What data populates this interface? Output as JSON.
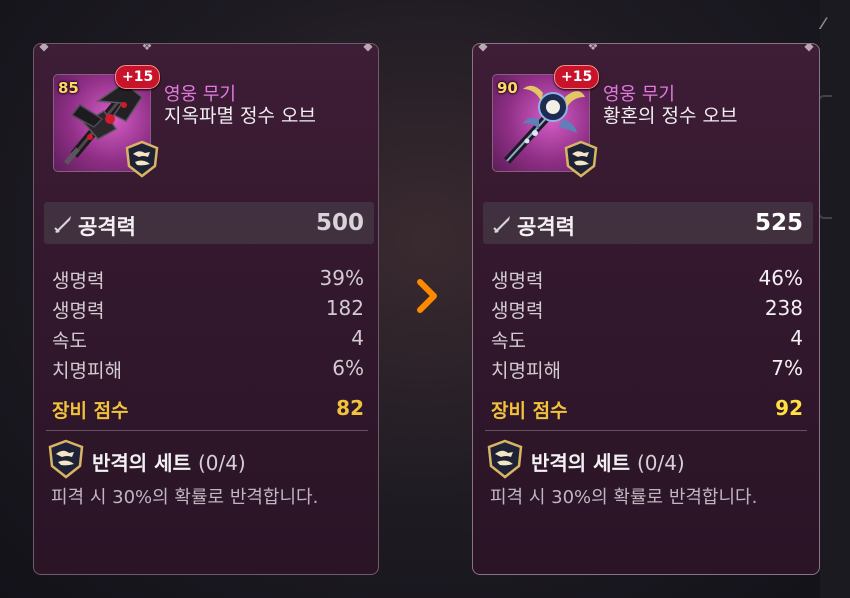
{
  "colors": {
    "rarity": "#e37ae0",
    "score": "#f1c33d",
    "plus_badge": "#c7142a",
    "arrow": "#ff8a00"
  },
  "compare_arrow_icon": "chevron-right-icon",
  "current": {
    "level": "85",
    "enhance": "+15",
    "rarity": "영웅 무기",
    "name": "지옥파멸 정수 오브",
    "attack_label": "공격력",
    "attack_value": "500",
    "stats": [
      {
        "label": "생명력",
        "value": "39%"
      },
      {
        "label": "생명력",
        "value": "182"
      },
      {
        "label": "속도",
        "value": "4"
      },
      {
        "label": "치명피해",
        "value": "6%"
      }
    ],
    "score_label": "장비 점수",
    "score_value": "82",
    "set_name": "반격의 세트",
    "set_count": "(0/4)",
    "set_desc": "피격 시 30%의 확률로 반격합니다."
  },
  "candidate": {
    "level": "90",
    "enhance": "+15",
    "rarity": "영웅 무기",
    "name": "황혼의 정수 오브",
    "attack_label": "공격력",
    "attack_value": "525",
    "stats": [
      {
        "label": "생명력",
        "value": "46%"
      },
      {
        "label": "생명력",
        "value": "238"
      },
      {
        "label": "속도",
        "value": "4"
      },
      {
        "label": "치명피해",
        "value": "7%"
      }
    ],
    "score_label": "장비 점수",
    "score_value": "92",
    "set_name": "반격의 세트",
    "set_count": "(0/4)",
    "set_desc": "피격 시 30%의 확률로 반격합니다."
  }
}
